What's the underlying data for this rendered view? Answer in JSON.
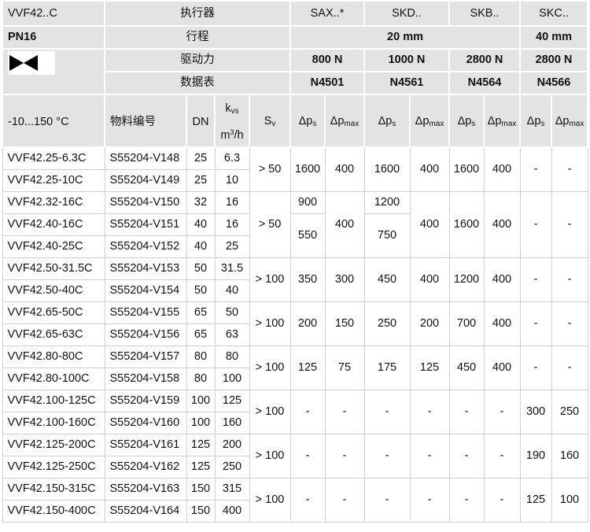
{
  "header": {
    "model_series": "VVF42..C",
    "pressure_class": "PN16",
    "actuator_label": "执行器",
    "stroke_label": "行程",
    "force_label": "驱动力",
    "datasheet_label": "数据表",
    "actuators": [
      "SAX..*",
      "SKD..",
      "SKB..",
      "SKC.."
    ],
    "strokes": [
      "20 mm",
      "40 mm"
    ],
    "forces": [
      "800 N",
      "1000 N",
      "2800 N",
      "2800 N"
    ],
    "datasheets": [
      "N4501",
      "N4561",
      "N4564",
      "N4566"
    ]
  },
  "columns": {
    "temp_range": "-10...150 °C",
    "part_no": "物料编号",
    "dn": "DN",
    "kvs_k": "k",
    "kvs_sub": "vs",
    "kvs_unit_base": "m",
    "kvs_unit_sup": "3",
    "kvs_unit_tail": "/h",
    "sv_s": "S",
    "sv_sub": "v",
    "dp_symbol": "Δp",
    "dps_sub": "s",
    "dpmax_sub": "max"
  },
  "colors": {
    "header_bg": "#e3e3e3",
    "grid": "#cfcfcf",
    "text": "#111111"
  },
  "icon": "valve-bowtie-icon",
  "rows": [
    {
      "type": "VVF42.25-6.3C",
      "part": "S55204-V148",
      "dn": "25",
      "kvs": "6.3"
    },
    {
      "type": "VVF42.25-10C",
      "part": "S55204-V149",
      "dn": "25",
      "kvs": "10"
    },
    {
      "type": "VVF42.32-16C",
      "part": "S55204-V150",
      "dn": "32",
      "kvs": "16"
    },
    {
      "type": "VVF42.40-16C",
      "part": "S55204-V151",
      "dn": "40",
      "kvs": "16"
    },
    {
      "type": "VVF42.40-25C",
      "part": "S55204-V152",
      "dn": "40",
      "kvs": "25"
    },
    {
      "type": "VVF42.50-31.5C",
      "part": "S55204-V153",
      "dn": "50",
      "kvs": "31.5"
    },
    {
      "type": "VVF42.50-40C",
      "part": "S55204-V154",
      "dn": "50",
      "kvs": "40"
    },
    {
      "type": "VVF42.65-50C",
      "part": "S55204-V155",
      "dn": "65",
      "kvs": "50"
    },
    {
      "type": "VVF42.65-63C",
      "part": "S55204-V156",
      "dn": "65",
      "kvs": "63"
    },
    {
      "type": "VVF42.80-80C",
      "part": "S55204-V157",
      "dn": "80",
      "kvs": "80"
    },
    {
      "type": "VVF42.80-100C",
      "part": "S55204-V158",
      "dn": "80",
      "kvs": "100"
    },
    {
      "type": "VVF42.100-125C",
      "part": "S55204-V159",
      "dn": "100",
      "kvs": "125"
    },
    {
      "type": "VVF42.100-160C",
      "part": "S55204-V160",
      "dn": "100",
      "kvs": "160"
    },
    {
      "type": "VVF42.125-200C",
      "part": "S55204-V161",
      "dn": "125",
      "kvs": "200"
    },
    {
      "type": "VVF42.125-250C",
      "part": "S55204-V162",
      "dn": "125",
      "kvs": "250"
    },
    {
      "type": "VVF42.150-315C",
      "part": "S55204-V163",
      "dn": "150",
      "kvs": "315"
    },
    {
      "type": "VVF42.150-400C",
      "part": "S55204-V164",
      "dn": "150",
      "kvs": "400"
    }
  ],
  "groups": {
    "g1": {
      "sv": "> 50",
      "sax_s": "1600",
      "sax_max": "400",
      "skd_s": "1600",
      "skd_max": "400",
      "skb_s": "1600",
      "skb_max": "400",
      "skc_s": "-",
      "skc_max": "-"
    },
    "g2": {
      "sv": "> 50",
      "sax_s_a": "900",
      "sax_s_b": "550",
      "sax_max": "400",
      "skd_s_a": "1200",
      "skd_s_b": "750",
      "skd_max": "400",
      "skb_s": "1600",
      "skb_max": "400",
      "skc_s": "-",
      "skc_max": "-"
    },
    "g3": {
      "sv": "> 100",
      "sax_s": "350",
      "sax_max": "300",
      "skd_s": "450",
      "skd_max": "400",
      "skb_s": "1200",
      "skb_max": "400",
      "skc_s": "-",
      "skc_max": "-"
    },
    "g4": {
      "sv": "> 100",
      "sax_s": "200",
      "sax_max": "150",
      "skd_s": "250",
      "skd_max": "200",
      "skb_s": "700",
      "skb_max": "400",
      "skc_s": "-",
      "skc_max": "-"
    },
    "g5": {
      "sv": "> 100",
      "sax_s": "125",
      "sax_max": "75",
      "skd_s": "175",
      "skd_max": "125",
      "skb_s": "450",
      "skb_max": "400",
      "skc_s": "-",
      "skc_max": "-"
    },
    "g6": {
      "sv": "> 100",
      "sax_s": "-",
      "sax_max": "-",
      "skd_s": "-",
      "skd_max": "-",
      "skb_s": "-",
      "skb_max": "-",
      "skc_s": "300",
      "skc_max": "250"
    },
    "g7": {
      "sv": "> 100",
      "sax_s": "-",
      "sax_max": "-",
      "skd_s": "-",
      "skd_max": "-",
      "skb_s": "-",
      "skb_max": "-",
      "skc_s": "190",
      "skc_max": "160"
    },
    "g8": {
      "sv": "> 100",
      "sax_s": "-",
      "sax_max": "-",
      "skd_s": "-",
      "skd_max": "-",
      "skb_s": "-",
      "skb_max": "-",
      "skc_s": "125",
      "skc_max": "100"
    }
  }
}
